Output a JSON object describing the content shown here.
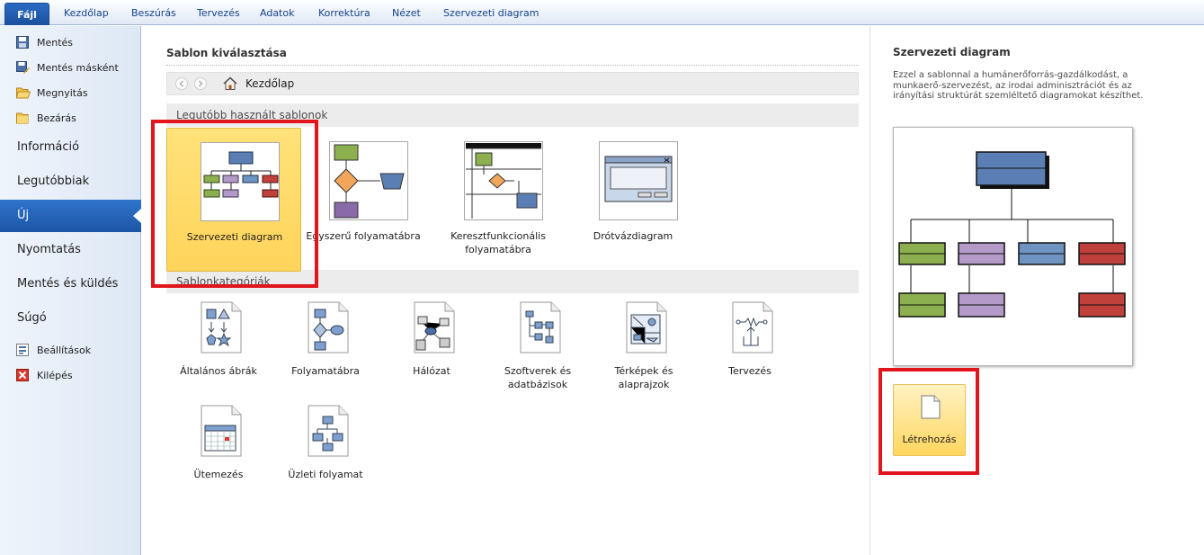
{
  "ribbon": {
    "file_tab": "Fájl",
    "tabs": [
      "Kezdőlap",
      "Beszúrás",
      "Tervezés",
      "Adatok",
      "Korrektúra",
      "Nézet",
      "Szervezeti diagram"
    ]
  },
  "nav": {
    "save": "Mentés",
    "save_as": "Mentés másként",
    "open": "Megnyitás",
    "close": "Bezárás",
    "info": "Információ",
    "recent": "Legutóbbiak",
    "new": "Új",
    "print": "Nyomtatás",
    "save_send": "Mentés és küldés",
    "help": "Súgó",
    "options": "Beállítások",
    "exit": "Kilépés"
  },
  "main": {
    "section_title": "Sablon kiválasztása",
    "breadcrumb_home": "Kezdőlap",
    "recent_header": "Legutóbb használt sablonok",
    "recent_templates": [
      "Szervezeti diagram",
      "Egyszerű folyamatábra",
      "Keresztfunkcionális folyamatábra",
      "Drótvázdiagram"
    ],
    "categories_header": "Sablonkategóriák",
    "categories": [
      "Általános ábrák",
      "Folyamatábra",
      "Hálózat",
      "Szoftverek és adatbázisok",
      "Térképek és alaprajzok",
      "Tervezés",
      "Ütemezés",
      "Üzleti folyamat"
    ]
  },
  "detail": {
    "title": "Szervezeti diagram",
    "description": "Ezzel a sablonnal a humánerőforrás-gazdálkodást, a munkaerő-szervezést, az irodai adminisztrációt és az irányítási struktúrát szemléltető diagramokat készíthet.",
    "create_label": "Létrehozás"
  },
  "colors": {
    "accent_blue": "#1d55a6",
    "selection_yellow": "#ffd45a",
    "highlight_red": "#e2141c"
  }
}
